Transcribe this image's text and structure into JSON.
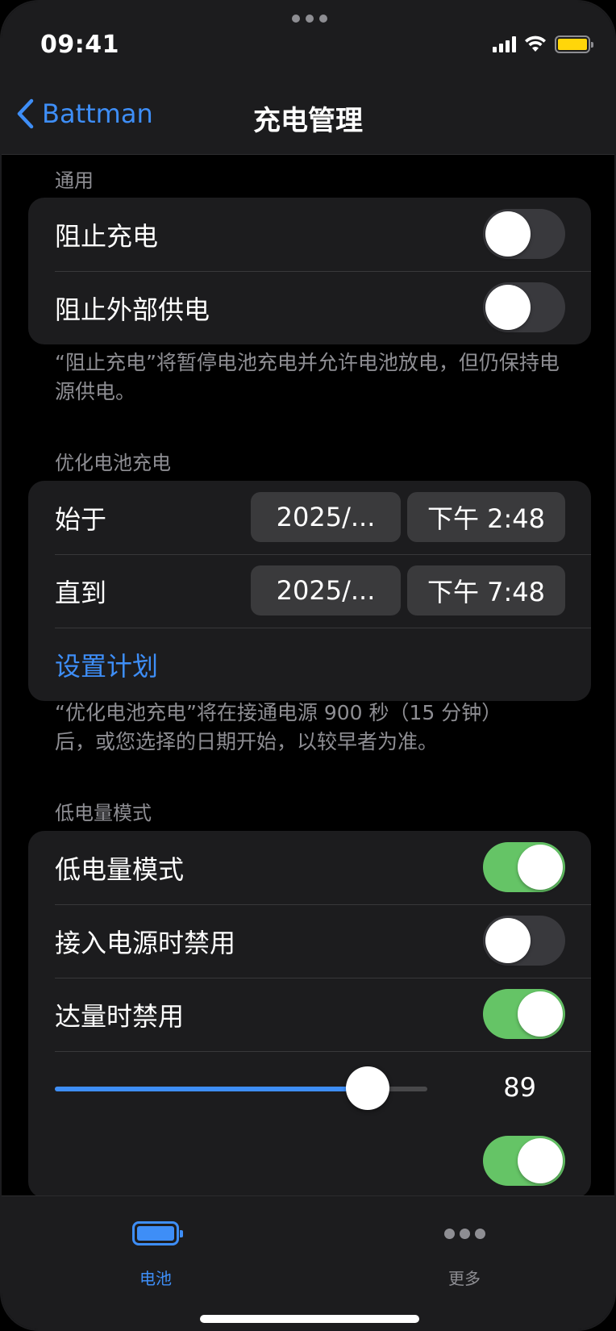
{
  "status_bar": {
    "time": "09:41"
  },
  "nav": {
    "back_label": "Battman",
    "title": "充电管理"
  },
  "general": {
    "header": "通用",
    "items": [
      {
        "label": "阻止充电",
        "on": false
      },
      {
        "label": "阻止外部供电",
        "on": false
      }
    ],
    "footer": "“阻止充电”将暂停电池充电并允许电池放电，但仍保持电源供电。"
  },
  "optimized": {
    "header": "优化电池充电",
    "start": {
      "label": "始于",
      "date": "2025/...",
      "time": "下午 2:48"
    },
    "end": {
      "label": "直到",
      "date": "2025/...",
      "time": "下午 7:48"
    },
    "set_schedule": "设置计划",
    "footer_line1": "“优化电池充电”将在接通电源 900 秒（15 分钟）",
    "footer_line2": "后，或您选择的日期开始，以较早者为准。"
  },
  "low_power": {
    "header": "低电量模式",
    "items": [
      {
        "label": "低电量模式",
        "on": true
      },
      {
        "label": "接入电源时禁用",
        "on": false
      },
      {
        "label": "达量时禁用",
        "on": true
      }
    ],
    "slider": {
      "value": 89,
      "value_label": "89",
      "fill_fraction": 0.84
    },
    "partial_row_toggle": true
  },
  "tabbar": {
    "tabs": [
      {
        "label": "电池",
        "icon": "battery-icon",
        "selected": true
      },
      {
        "label": "更多",
        "icon": "more-icon",
        "selected": false
      }
    ]
  },
  "colors": {
    "accent": "#3e8ef7",
    "toggle_on": "#65c466",
    "toggle_off": "#39393d",
    "status_battery": "#ffd60a",
    "cell_background": "#1c1c1e",
    "secondary_text": "#8e8e93"
  }
}
